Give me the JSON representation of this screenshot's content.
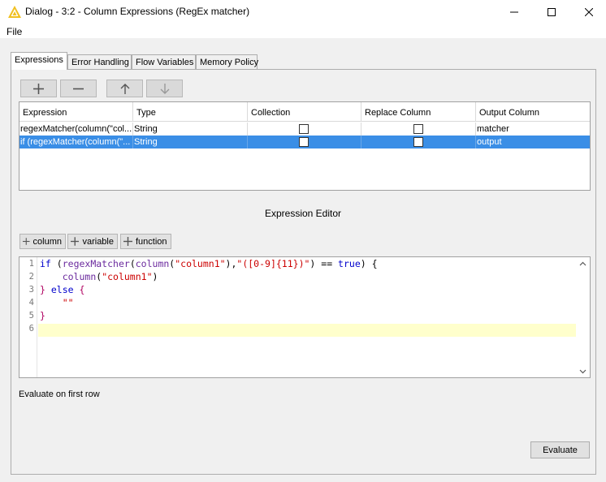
{
  "window": {
    "title": "Dialog - 3:2 - Column Expressions (RegEx matcher)",
    "accent_color": "#f0c020"
  },
  "menu": {
    "file": "File"
  },
  "tabs": [
    {
      "label": "Expressions",
      "active": true
    },
    {
      "label": "Error Handling",
      "active": false
    },
    {
      "label": "Flow Variables",
      "active": false
    },
    {
      "label": "Memory Policy",
      "active": false
    }
  ],
  "toolbar": {
    "add_icon": "plus-icon",
    "remove_icon": "minus-icon",
    "up_icon": "arrow-up-icon",
    "down_icon": "arrow-down-icon"
  },
  "table": {
    "columns": [
      "Expression",
      "Type",
      "Collection",
      "Replace Column",
      "Output Column"
    ],
    "rows": [
      {
        "expression": "regexMatcher(column(\"col...",
        "type": "String",
        "collection": false,
        "replace": false,
        "output": "matcher",
        "selected": false
      },
      {
        "expression": "if (regexMatcher(column(\"...",
        "type": "String",
        "collection": false,
        "replace": false,
        "output": "output",
        "selected": true
      }
    ],
    "selection_color": "#3a8ee6"
  },
  "editor": {
    "title": "Expression Editor",
    "buttons": [
      "column",
      "variable",
      "function"
    ],
    "line_numbers": [
      "1",
      "2",
      "3",
      "4",
      "5",
      "6"
    ],
    "current_line": 6,
    "code": {
      "l1_if": "if",
      "l1_open": " (",
      "l1_fn": "regexMatcher",
      "l1_p1": "(",
      "l1_col": "column",
      "l1_p2": "(",
      "l1_s1": "\"column1\"",
      "l1_p3": "),",
      "l1_s2": "\"([0-9]{11})\"",
      "l1_p4": ") == ",
      "l1_true": "true",
      "l1_p5": ") {",
      "l2_col": "column",
      "l2_p1": "(",
      "l2_s": "\"column1\"",
      "l2_p2": ")",
      "l3_close": "}",
      "l3_else": " else ",
      "l3_open": "{",
      "l4_s": "\"\"",
      "l5_close": "}"
    }
  },
  "evaluate": {
    "label": "Evaluate on first row",
    "button": "Evaluate"
  }
}
